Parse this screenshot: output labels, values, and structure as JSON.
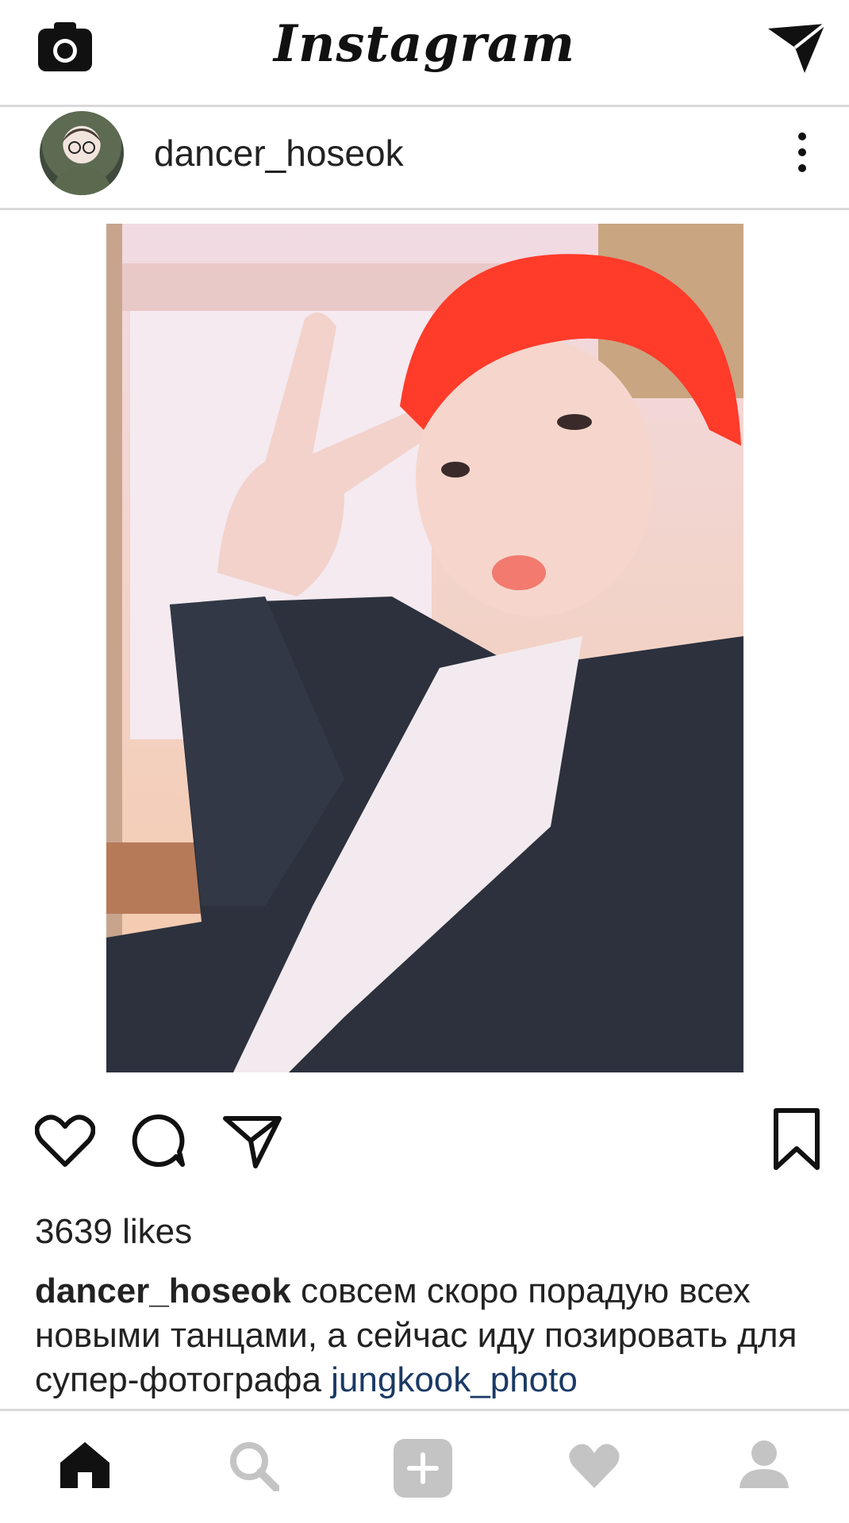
{
  "top_bar": {
    "logo": "Instagram",
    "left_icon": "camera-icon",
    "right_icon": "direct-message-icon"
  },
  "post": {
    "username": "dancer_hoseok",
    "menu_icon": "more-vertical-icon",
    "likes": "3639 likes",
    "caption_username": "dancer_hoseok",
    "caption_text": " совсем скоро порадую всех новыми танцами, а сейчас иду позировать для супер-фотографа ",
    "caption_mention": "jungkook_photo"
  },
  "actions": [
    "heart-icon",
    "comment-icon",
    "share-icon",
    "bookmark-icon"
  ],
  "bottom_nav": [
    "home-icon",
    "search-icon",
    "add-post-icon",
    "activity-heart-icon",
    "profile-icon"
  ],
  "colors": {
    "mention": "#1a3a66",
    "inactive_nav": "#c4c4c4",
    "divider": "#d9d9d9"
  }
}
